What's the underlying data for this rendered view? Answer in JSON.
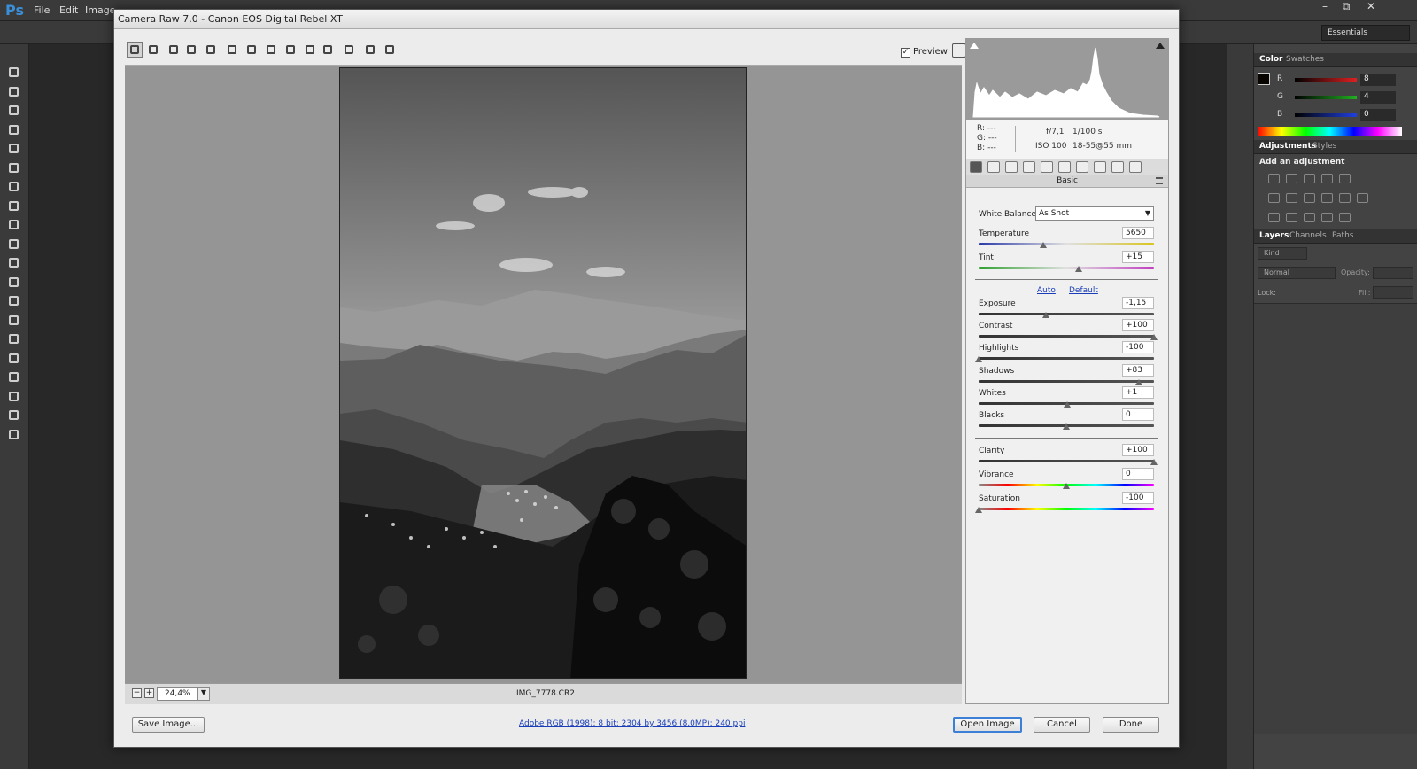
{
  "ps": {
    "logo": "Ps",
    "menus": [
      "File",
      "Edit",
      "Image"
    ],
    "window_controls": [
      "–",
      "⧉",
      "✕"
    ],
    "workspace": "Essentials",
    "panels": {
      "color_tabs": [
        "Color",
        "Swatches"
      ],
      "color": {
        "channels": [
          {
            "label": "R",
            "value": "8",
            "color": "#e02020"
          },
          {
            "label": "G",
            "value": "4",
            "color": "#20b020"
          },
          {
            "label": "B",
            "value": "0",
            "color": "#2040e0"
          }
        ]
      },
      "adjust_tabs": [
        "Adjustments",
        "Styles"
      ],
      "adjust_heading": "Add an adjustment",
      "layer_tabs": [
        "Layers",
        "Channels",
        "Paths"
      ],
      "layers": {
        "kind": "Kind",
        "blend_mode": "Normal",
        "opacity_label": "Opacity:",
        "lock_label": "Lock:",
        "fill_label": "Fill:"
      }
    }
  },
  "dialog": {
    "title": "Camera Raw 7.0  -  Canon EOS Digital Rebel XT",
    "preview_label": "Preview",
    "preview_checked": true,
    "zoom": "24,4%",
    "zoom_out": "−",
    "zoom_in": "+",
    "file_name": "IMG_7778.CR2",
    "readout": {
      "r": "R:  ---",
      "g": "G:  ---",
      "b": "B:  ---",
      "aperture": "f/7,1",
      "shutter": "1/100 s",
      "iso": "ISO 100",
      "lens": "18-55@55 mm"
    },
    "panel_name": "Basic",
    "white_balance": {
      "label": "White Balance:",
      "value": "As Shot"
    },
    "sliders_wb": [
      {
        "label": "Temperature",
        "value": "5650",
        "position": 0.37
      },
      {
        "label": "Tint",
        "value": "+15",
        "position": 0.57
      }
    ],
    "auto_label": "Auto",
    "default_label": "Default",
    "sliders_tone": [
      {
        "label": "Exposure",
        "value": "-1,15",
        "position": 0.385
      },
      {
        "label": "Contrast",
        "value": "+100",
        "position": 1.0
      },
      {
        "label": "Highlights",
        "value": "-100",
        "position": 0.0
      },
      {
        "label": "Shadows",
        "value": "+83",
        "position": 0.915
      },
      {
        "label": "Whites",
        "value": "+1",
        "position": 0.505
      },
      {
        "label": "Blacks",
        "value": "0",
        "position": 0.5
      }
    ],
    "sliders_presence": [
      {
        "label": "Clarity",
        "value": "+100",
        "position": 1.0
      },
      {
        "label": "Vibrance",
        "value": "0",
        "position": 0.5
      },
      {
        "label": "Saturation",
        "value": "-100",
        "position": 0.0
      }
    ],
    "save_button": "Save Image...",
    "workflow_options": "Adobe RGB (1998); 8 bit; 2304 by 3456 (8,0MP); 240 ppi",
    "open_button": "Open Image",
    "cancel_button": "Cancel",
    "done_button": "Done"
  },
  "colors": {
    "accent": "#3c7fd6",
    "link": "#1a3eb8",
    "canvas_bg": "#959595",
    "ps_dark": "#3a3a3a"
  }
}
